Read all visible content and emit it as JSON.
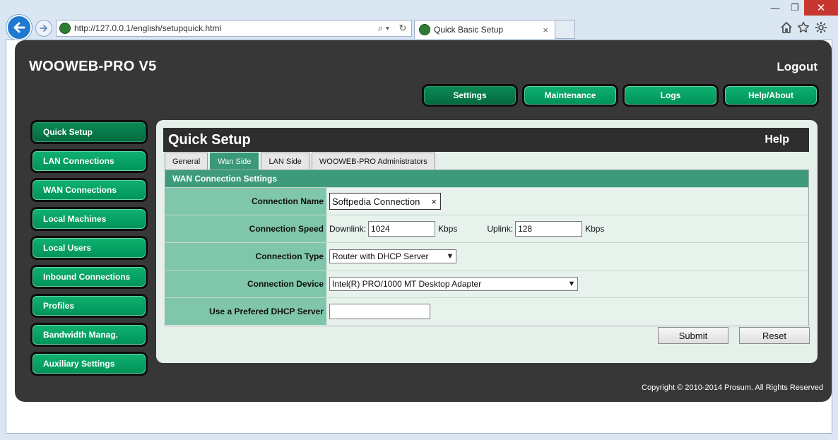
{
  "browser": {
    "url": "http://127.0.0.1/english/setupquick.html",
    "tab_title": "Quick Basic Setup",
    "tab_close": "×",
    "search_tool": "⌕ ▾",
    "refresh_tool": "↻",
    "window_min": "—",
    "window_max": "❐",
    "window_close": "✕"
  },
  "header": {
    "app_title": "WOOWEB-PRO V5",
    "logout": "Logout"
  },
  "top_nav": {
    "items": [
      "Settings",
      "Maintenance",
      "Logs",
      "Help/About"
    ],
    "active": "Settings"
  },
  "sidebar": {
    "items": [
      "Quick Setup",
      "LAN Connections",
      "WAN Connections",
      "Local Machines",
      "Local Users",
      "Inbound Connections",
      "Profiles",
      "Bandwidth Manag.",
      "Auxiliary Settings"
    ],
    "active": "Quick Setup"
  },
  "panel": {
    "title": "Quick Setup",
    "help": "Help",
    "tabs": [
      "General",
      "Wan Side",
      "LAN Side",
      "WOOWEB-PRO Administrators"
    ],
    "active_tab": "Wan Side"
  },
  "form": {
    "section_title": "WAN Connection Settings",
    "connection_name": {
      "label": "Connection Name",
      "value": "Softpedia Connection",
      "clear": "×"
    },
    "connection_speed": {
      "label": "Connection Speed",
      "downlink_label": "Downlink:",
      "downlink_value": "1024",
      "downlink_unit": "Kbps",
      "uplink_label": "Uplink:",
      "uplink_value": "128",
      "uplink_unit": "Kbps"
    },
    "connection_type": {
      "label": "Connection Type",
      "value": "Router with DHCP Server"
    },
    "connection_device": {
      "label": "Connection Device",
      "value": "Intel(R) PRO/1000 MT Desktop Adapter"
    },
    "dhcp_server": {
      "label": "Use a Prefered DHCP Server",
      "value": ""
    },
    "submit": "Submit",
    "reset": "Reset"
  },
  "footer": {
    "copyright": "Copyright © 2010-2014 Prosum. All Rights Reserved"
  },
  "colors": {
    "accent_green": "#009a5e",
    "form_label_bg": "#7fc6ab",
    "panel_bg": "#e5f0ea",
    "app_bg": "#373737"
  }
}
